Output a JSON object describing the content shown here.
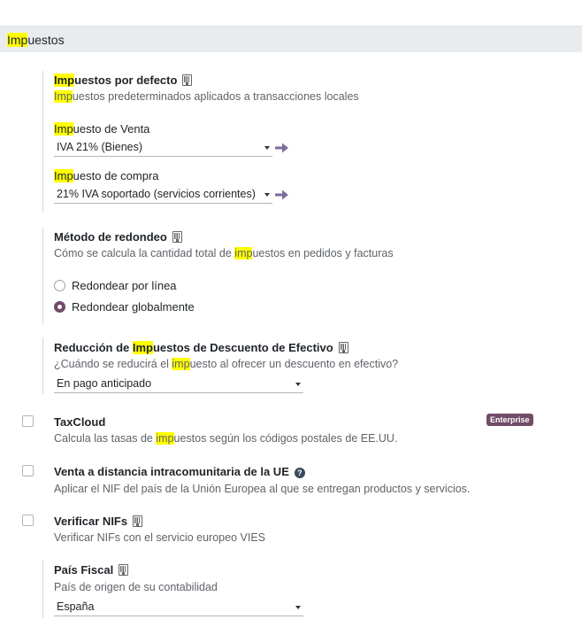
{
  "section": {
    "title_hl": "Imp",
    "title_rest": "uestos"
  },
  "default_taxes": {
    "title_hl": "Imp",
    "title_rest": "uestos por defecto",
    "desc_hl": "Imp",
    "desc_rest": "uestos predeterminados aplicados a transacciones locales",
    "sale": {
      "label_hl": "Imp",
      "label_rest": "uesto de Venta",
      "value": "IVA 21% (Bienes)"
    },
    "purchase": {
      "label_hl": "Imp",
      "label_rest": "uesto de compra",
      "value": "21% IVA soportado (servicios corrientes)"
    }
  },
  "rounding": {
    "title": "Método de redondeo",
    "desc_pre": "Cómo se calcula la cantidad total de ",
    "desc_hl": "imp",
    "desc_post": "uestos en pedidos y facturas",
    "options": [
      "Redondear por línea",
      "Redondear globalmente"
    ],
    "selected_index": 1
  },
  "cash_discount": {
    "title_pre": "Reducción de ",
    "title_hl": "Imp",
    "title_post": "uestos de Descuento de Efectivo",
    "desc_pre": "¿Cuándo se reducirá el ",
    "desc_hl": "imp",
    "desc_post": "uesto al ofrecer un descuento en efectivo?",
    "value": "En pago anticipado"
  },
  "taxcloud": {
    "title": "TaxCloud",
    "badge": "Enterprise",
    "desc_pre": "Calcula las tasas de ",
    "desc_hl": "imp",
    "desc_post": "uestos según los códigos postales de EE.UU.",
    "checked": false
  },
  "eu_distance": {
    "title": "Venta a distancia intracomunitaria de la UE",
    "help_icon": "?",
    "desc": "Aplicar el NIF del país de la Unión Europea al que se entregan productos y servicios.",
    "checked": false
  },
  "vat_check": {
    "title": "Verificar NIFs",
    "desc": "Verificar NIFs con el servicio europeo VIES",
    "checked": false
  },
  "fiscal_country": {
    "title": "País Fiscal",
    "desc": "País de origen de su contabilidad",
    "value": "España"
  },
  "colors": {
    "highlight": "#ffff00",
    "accent": "#714b67",
    "arrow": "#7c6d9b"
  }
}
